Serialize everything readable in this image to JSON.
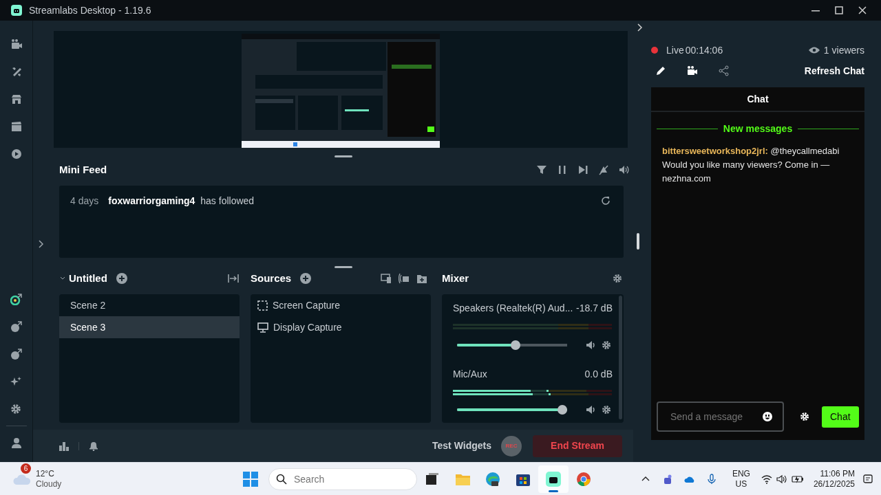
{
  "window": {
    "title": "Streamlabs Desktop - 1.19.6"
  },
  "mini_feed": {
    "title": "Mini Feed",
    "events": [
      {
        "time": "4 days",
        "user": "foxwarriorgaming4",
        "action": "has followed"
      }
    ]
  },
  "scenes": {
    "title": "Untitled",
    "expanded": true,
    "items": [
      {
        "label": "Scene 2",
        "selected": false
      },
      {
        "label": "Scene 3",
        "selected": true
      }
    ]
  },
  "sources": {
    "title": "Sources",
    "items": [
      {
        "label": "Screen Capture",
        "kind": "region"
      },
      {
        "label": "Display Capture",
        "kind": "monitor"
      }
    ]
  },
  "mixer": {
    "title": "Mixer",
    "channels": [
      {
        "name": "Speakers (Realtek(R) Aud...",
        "reading": "-18.7 dB",
        "level": 0.53,
        "signal": false
      },
      {
        "name": "Mic/Aux",
        "reading": "0.0 dB",
        "level": 1,
        "signal": true
      }
    ]
  },
  "footer": {
    "test_widgets": "Test Widgets",
    "rec": "REC",
    "end_stream": "End Stream"
  },
  "stream": {
    "status": "Live",
    "time": "00:14:06",
    "viewers": "1 viewers",
    "refresh": "Refresh Chat"
  },
  "chat": {
    "title": "Chat",
    "divider": "New messages",
    "messages": [
      {
        "user": "bittersweetworkshop2jrl:",
        "text": "@theycallmedabi Would you like many viewers? Come in — nezhna.com"
      }
    ],
    "input": {
      "placeholder": "Send a message"
    },
    "send": "Chat"
  },
  "taskbar": {
    "weather": {
      "badge": "6",
      "temp": "12°C",
      "condition": "Cloudy"
    },
    "search": {
      "placeholder": "Search"
    },
    "language": "ENG",
    "region": "US",
    "time": "11:06 PM",
    "date": "26/12/2025"
  }
}
